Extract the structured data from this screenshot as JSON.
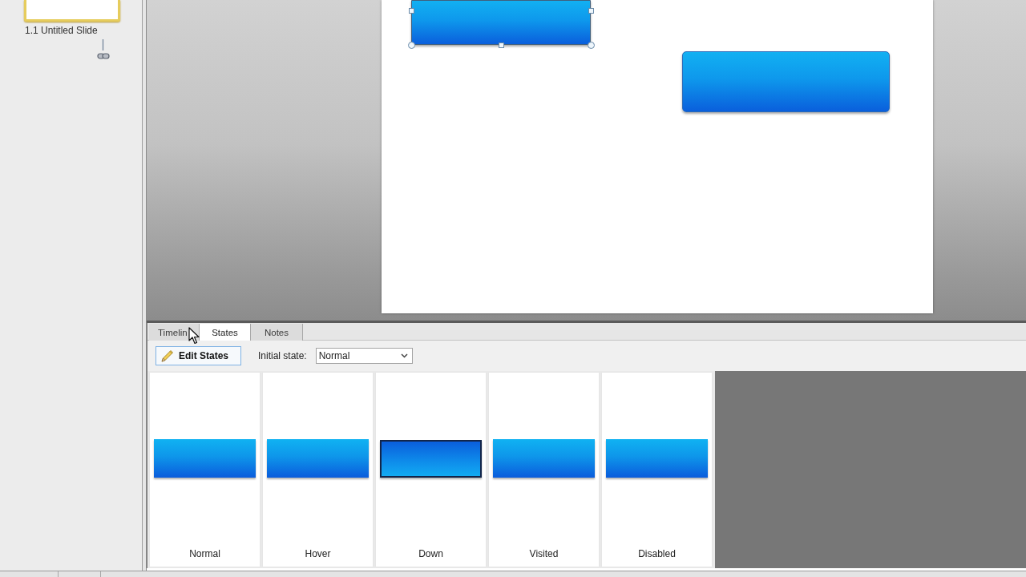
{
  "sidebar": {
    "slides": [
      {
        "label": "1.1 Untitled Slide",
        "selected": true
      }
    ]
  },
  "stage": {
    "objects": [
      {
        "kind": "button",
        "selected": true
      },
      {
        "kind": "button",
        "selected": false
      }
    ]
  },
  "panel": {
    "tabs": [
      {
        "label": "Timelin",
        "selected": false
      },
      {
        "label": "States",
        "selected": true
      },
      {
        "label": "Notes",
        "selected": false
      }
    ],
    "edit_button": "Edit States",
    "initial_state": {
      "label": "Initial state:",
      "value": "Normal"
    },
    "states": [
      {
        "label": "Normal",
        "kind": "raised"
      },
      {
        "label": "Hover",
        "kind": "raised"
      },
      {
        "label": "Down",
        "kind": "pressed"
      },
      {
        "label": "Visited",
        "kind": "raised"
      },
      {
        "label": "Disabled",
        "kind": "raised"
      }
    ]
  }
}
